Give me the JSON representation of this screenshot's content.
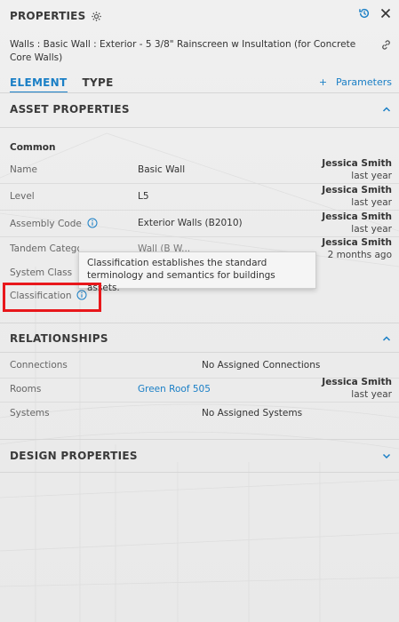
{
  "header": {
    "title": "PROPERTIES",
    "gear_icon": "gear-icon",
    "history_icon": "history-icon",
    "close_icon": "close-icon"
  },
  "element": {
    "name": "Walls : Basic Wall : Exterior - 5 3/8\" Rainscreen w Insultation (for Concrete Core Walls)",
    "link_icon": "link-icon"
  },
  "tabs": [
    {
      "label": "ELEMENT",
      "active": true
    },
    {
      "label": "TYPE",
      "active": false
    }
  ],
  "parameters_button": {
    "plus": "+",
    "label": "Parameters"
  },
  "asset_properties": {
    "title": "ASSET PROPERTIES",
    "group": "Common",
    "rows": [
      {
        "label": "Name",
        "value": "Basic Wall",
        "user": "Jessica Smith",
        "when": "last year"
      },
      {
        "label": "Level",
        "value": "L5",
        "user": "Jessica Smith",
        "when": "last year"
      },
      {
        "label": "Assembly Code",
        "value": "Exterior Walls (B2010)",
        "user": "Jessica Smith",
        "when": "last year"
      },
      {
        "label": "Tandem Catego",
        "value": "Wall (B W...",
        "user": "Jessica Smith",
        "when": "2 months ago"
      },
      {
        "label": "System Class",
        "value": "",
        "user": "",
        "when": ""
      },
      {
        "label": "Classification",
        "value": "",
        "user": "",
        "when": ""
      }
    ]
  },
  "tooltip": {
    "text": "Classification establishes the standard terminology and semantics for buildings assets."
  },
  "relationships": {
    "title": "RELATIONSHIPS",
    "rows": [
      {
        "label": "Connections",
        "value": "No Assigned Connections"
      },
      {
        "label": "Rooms",
        "value": "Green Roof 505",
        "user": "Jessica Smith",
        "when": "last year"
      },
      {
        "label": "Systems",
        "value": "No Assigned Systems"
      }
    ]
  },
  "design_properties": {
    "title": "DESIGN PROPERTIES"
  },
  "colors": {
    "accent": "#1a7fc6",
    "highlight": "#e8171b"
  }
}
